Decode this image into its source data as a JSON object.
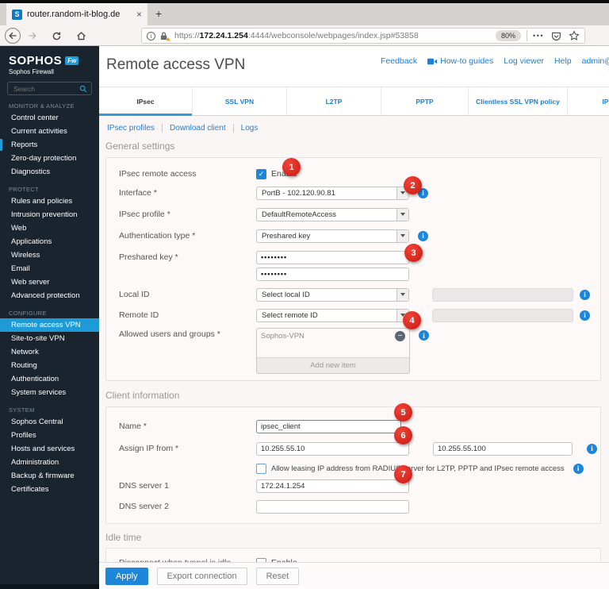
{
  "browser": {
    "tab_title": "router.random-it-blog.de",
    "favicon_letter": "S",
    "url_scheme": "https://",
    "url_host": "172.24.1.254",
    "url_path": ":4444/webconsole/webpages/index.jsp#53858",
    "zoom_badge": "80%"
  },
  "icons": {
    "close": "×",
    "new_tab": "+",
    "overflow_menu": "•••",
    "check": "✓",
    "remove": "−",
    "info": "i"
  },
  "sidebar": {
    "brand": "SOPHOS",
    "brand_badge": "Fw",
    "brand_subtitle": "Sophos Firewall",
    "search_placeholder": "Search",
    "sections": [
      {
        "label": "MONITOR & ANALYZE",
        "items": [
          "Control center",
          "Current activities",
          "Reports",
          "Zero-day protection",
          "Diagnostics"
        ]
      },
      {
        "label": "PROTECT",
        "items": [
          "Rules and policies",
          "Intrusion prevention",
          "Web",
          "Applications",
          "Wireless",
          "Email",
          "Web server",
          "Advanced protection"
        ]
      },
      {
        "label": "CONFIGURE",
        "items": [
          "Remote access VPN",
          "Site-to-site VPN",
          "Network",
          "Routing",
          "Authentication",
          "System services"
        ]
      },
      {
        "label": "SYSTEM",
        "items": [
          "Sophos Central",
          "Profiles",
          "Hosts and services",
          "Administration",
          "Backup & firmware",
          "Certificates"
        ]
      }
    ],
    "active_item": "Remote access VPN"
  },
  "header": {
    "title": "Remote access VPN",
    "links": [
      "Feedback",
      "How-to guides",
      "Log viewer",
      "Help",
      "admin@router.rand"
    ]
  },
  "tabs": {
    "items": [
      "IPsec",
      "SSL VPN",
      "L2TP",
      "PPTP",
      "Clientless SSL VPN policy",
      "IPsec"
    ],
    "active": "IPsec"
  },
  "subnav": {
    "links": [
      "IPsec profiles",
      "Download client",
      "Logs"
    ]
  },
  "general_settings": {
    "heading": "General settings",
    "ipsec_remote_access_label": "IPsec remote access",
    "enable_label": "Enable",
    "interface_label": "Interface *",
    "interface_value": "PortB - 102.120.90.81",
    "profile_label": "IPsec profile *",
    "profile_value": "DefaultRemoteAccess",
    "auth_type_label": "Authentication type *",
    "auth_type_value": "Preshared key",
    "psk_label": "Preshared key *",
    "psk_value": "••••••••",
    "psk_confirm_value": "••••••••",
    "local_id_label": "Local ID",
    "local_id_value": "Select local ID",
    "remote_id_label": "Remote ID",
    "remote_id_value": "Select remote ID",
    "allowed_label": "Allowed users and groups *",
    "allowed_item": "Sophos-VPN",
    "add_new_item": "Add new item"
  },
  "client_information": {
    "heading": "Client information",
    "name_label": "Name *",
    "name_value": "ipsec_client",
    "assign_label": "Assign IP from *",
    "assign_from": "10.255.55.10",
    "assign_to": "10.255.55.100",
    "radius_label": "Allow leasing IP address from RADIUS server for L2TP, PPTP and IPsec remote access",
    "dns1_label": "DNS server 1",
    "dns1_value": "172.24.1.254",
    "dns2_label": "DNS server 2",
    "dns2_value": ""
  },
  "idle_time": {
    "heading": "Idle time",
    "disconnect_label": "Disconnect when tunnel is idle",
    "enable_label": "Enable"
  },
  "footer": {
    "apply": "Apply",
    "export": "Export connection",
    "reset": "Reset"
  },
  "annotations": {
    "steps": [
      "1",
      "2",
      "3",
      "4",
      "5",
      "6",
      "7"
    ]
  },
  "colors": {
    "sidebar_navy": "#19242f",
    "active_nav_blue": "#1e9bd7",
    "link_blue": "#1b7fd6",
    "accent_blue": "#1d86d8",
    "badge_red": "#dc1f1a",
    "warning_orange": "#e8a71c"
  }
}
